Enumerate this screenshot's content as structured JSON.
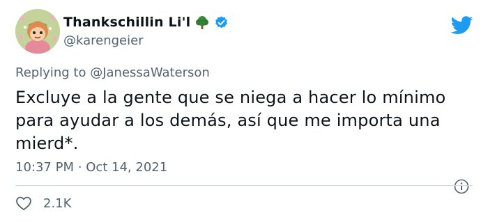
{
  "author": {
    "display_name": "Thankschillin Li'l",
    "handle": "@karengeier",
    "avatar_icon": "animal-crossing-avatar",
    "emoji_icon": "tree-icon",
    "verified": true
  },
  "reply": {
    "prefix": "Replying to",
    "mention": "@JanessaWaterson"
  },
  "tweet": {
    "text": "Excluye a la gente que se niega a hacer lo mínimo para ayudar a los demás, así que me importa una mierd*.",
    "time": "10:37 PM",
    "separator": "·",
    "date": "Oct 14, 2021"
  },
  "stats": {
    "likes": "2.1K"
  },
  "colors": {
    "brand": "#1d9bf0",
    "text": "#0f1419",
    "secondary": "#536471",
    "divider": "#cfd9de"
  }
}
